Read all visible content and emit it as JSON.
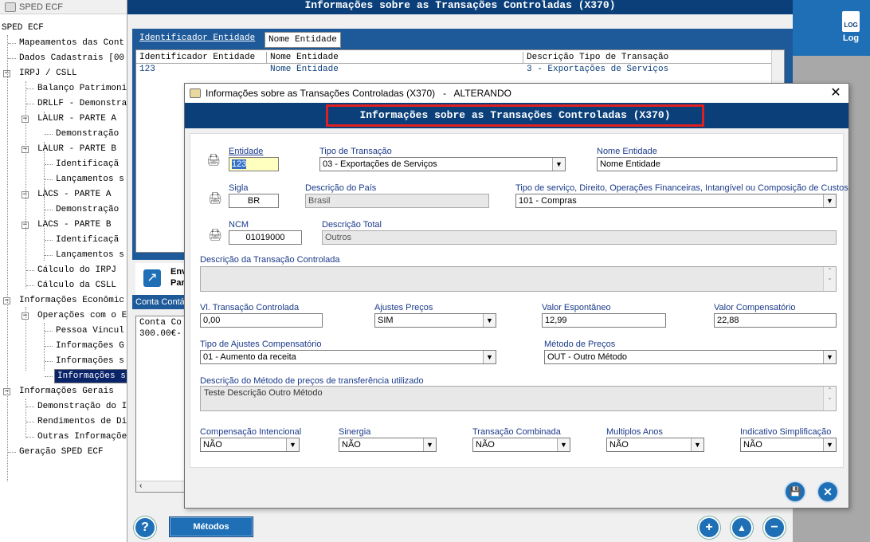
{
  "tree": {
    "title": "SPED ECF",
    "items": [
      {
        "label": "SPED ECF"
      },
      {
        "label": "Mapeamentos das Cont"
      },
      {
        "label": "Dados Cadastrais [00"
      },
      {
        "label": "IRPJ / CSLL"
      },
      {
        "label": "Balanço Patrimoni"
      },
      {
        "label": "DRLLF - Demonstra"
      },
      {
        "label": "LALUR - PARTE A"
      },
      {
        "label": "Demonstração"
      },
      {
        "label": "LALUR - PARTE B"
      },
      {
        "label": "Identificaçã"
      },
      {
        "label": "Lançamentos s"
      },
      {
        "label": "LACS - PARTE A"
      },
      {
        "label": "Demonstração"
      },
      {
        "label": "LACS - PARTE B"
      },
      {
        "label": "Identificaçã"
      },
      {
        "label": "Lançamentos s"
      },
      {
        "label": "Cálculo do IRPJ"
      },
      {
        "label": "Cálculo da CSLL"
      },
      {
        "label": "Informações Econômic"
      },
      {
        "label": "Operações com o E"
      },
      {
        "label": "Pessoa Vincul"
      },
      {
        "label": "Informações G"
      },
      {
        "label": "Informações s"
      },
      {
        "label": "Informações s"
      },
      {
        "label": "Informações Gerais"
      },
      {
        "label": "Demonstração do I"
      },
      {
        "label": "Rendimentos de Di"
      },
      {
        "label": "Outras Informaçõe"
      },
      {
        "label": "Geração SPED ECF"
      }
    ]
  },
  "main": {
    "title": "Informações sobre as Transações Controladas (X370)",
    "log_label": "Log",
    "log_icon_text": "LOG",
    "tabs": [
      "Identificador Entidade",
      "Nome Entidade"
    ],
    "grid": {
      "headers": [
        "Identificador Entidade",
        "Nome Entidade",
        "Descrição Tipo de Transação"
      ],
      "row": [
        "123",
        "Nome Entidade",
        "3 - Exportações de Serviços"
      ]
    },
    "lower_panel": {
      "line1": "Env",
      "line2": "Par"
    },
    "conta_label": "Conta Contá",
    "conta_grid": {
      "header": "Conta Co",
      "value": "300.00€-"
    },
    "metodos_label": "Métodos",
    "help_glyph": "?",
    "add_glyph": "+",
    "up_glyph": "▲",
    "remove_glyph": "−"
  },
  "dialog": {
    "title": "Informações sobre as Transações Controladas (X370)   -   ALTERANDO",
    "header": "Informações sobre as Transações Controladas (X370)",
    "fields": {
      "entidade": {
        "label": "Entidade",
        "value": "123"
      },
      "tipo_transacao": {
        "label": "Tipo de Transação",
        "value": "03 - Exportações de Serviços"
      },
      "nome_entidade": {
        "label": "Nome Entidade",
        "value": "Nome Entidade"
      },
      "sigla": {
        "label": "Sigla",
        "value": "BR"
      },
      "descricao_pais": {
        "label": "Descrição do País",
        "value": "Brasil"
      },
      "tipo_servico": {
        "label": "Tipo de serviço, Direito, Operações Financeiras, Intangível ou Composição de Custos",
        "value": "101 - Compras"
      },
      "ncm": {
        "label": "NCM",
        "value": "01019000"
      },
      "descricao_total": {
        "label": "Descrição Total",
        "value": "Outros"
      },
      "descricao_transacao": {
        "label": "Descrição da Transação Controlada",
        "value": ""
      },
      "vl_transacao": {
        "label": "Vl. Transação Controlada",
        "value": "0,00"
      },
      "ajustes_precos": {
        "label": "Ajustes Preços",
        "value": "SIM"
      },
      "valor_espontaneo": {
        "label": "Valor Espontâneo",
        "value": "12,99"
      },
      "valor_compensatorio": {
        "label": "Valor Compensatório",
        "value": "22,88"
      },
      "tipo_ajustes": {
        "label": "Tipo de Ajustes Compensatório",
        "value": "01 - Aumento da receita"
      },
      "metodo_precos": {
        "label": "Método de Preços",
        "value": "OUT - Outro Método"
      },
      "descricao_metodo": {
        "label": "Descrição do Método de preços de transferência utilizado",
        "value": "Teste Descrição Outro Método"
      },
      "compensacao": {
        "label": "Compensação Intencional",
        "value": "NÃO"
      },
      "sinergia": {
        "label": "Sinergia",
        "value": "NÃO"
      },
      "transacao_combinada": {
        "label": "Transação Combinada",
        "value": "NÃO"
      },
      "multiplos_anos": {
        "label": "Multiplos Anos",
        "value": "NÃO"
      },
      "indicativo": {
        "label": "Indicativo Simplificação",
        "value": "NÃO"
      }
    },
    "close_glyph": "✕",
    "save_glyph": "💾",
    "cancel_glyph": "✕"
  },
  "colors": {
    "navy": "#0a3f7a",
    "accent": "#1e6fb6",
    "highlight": "#e02020"
  }
}
